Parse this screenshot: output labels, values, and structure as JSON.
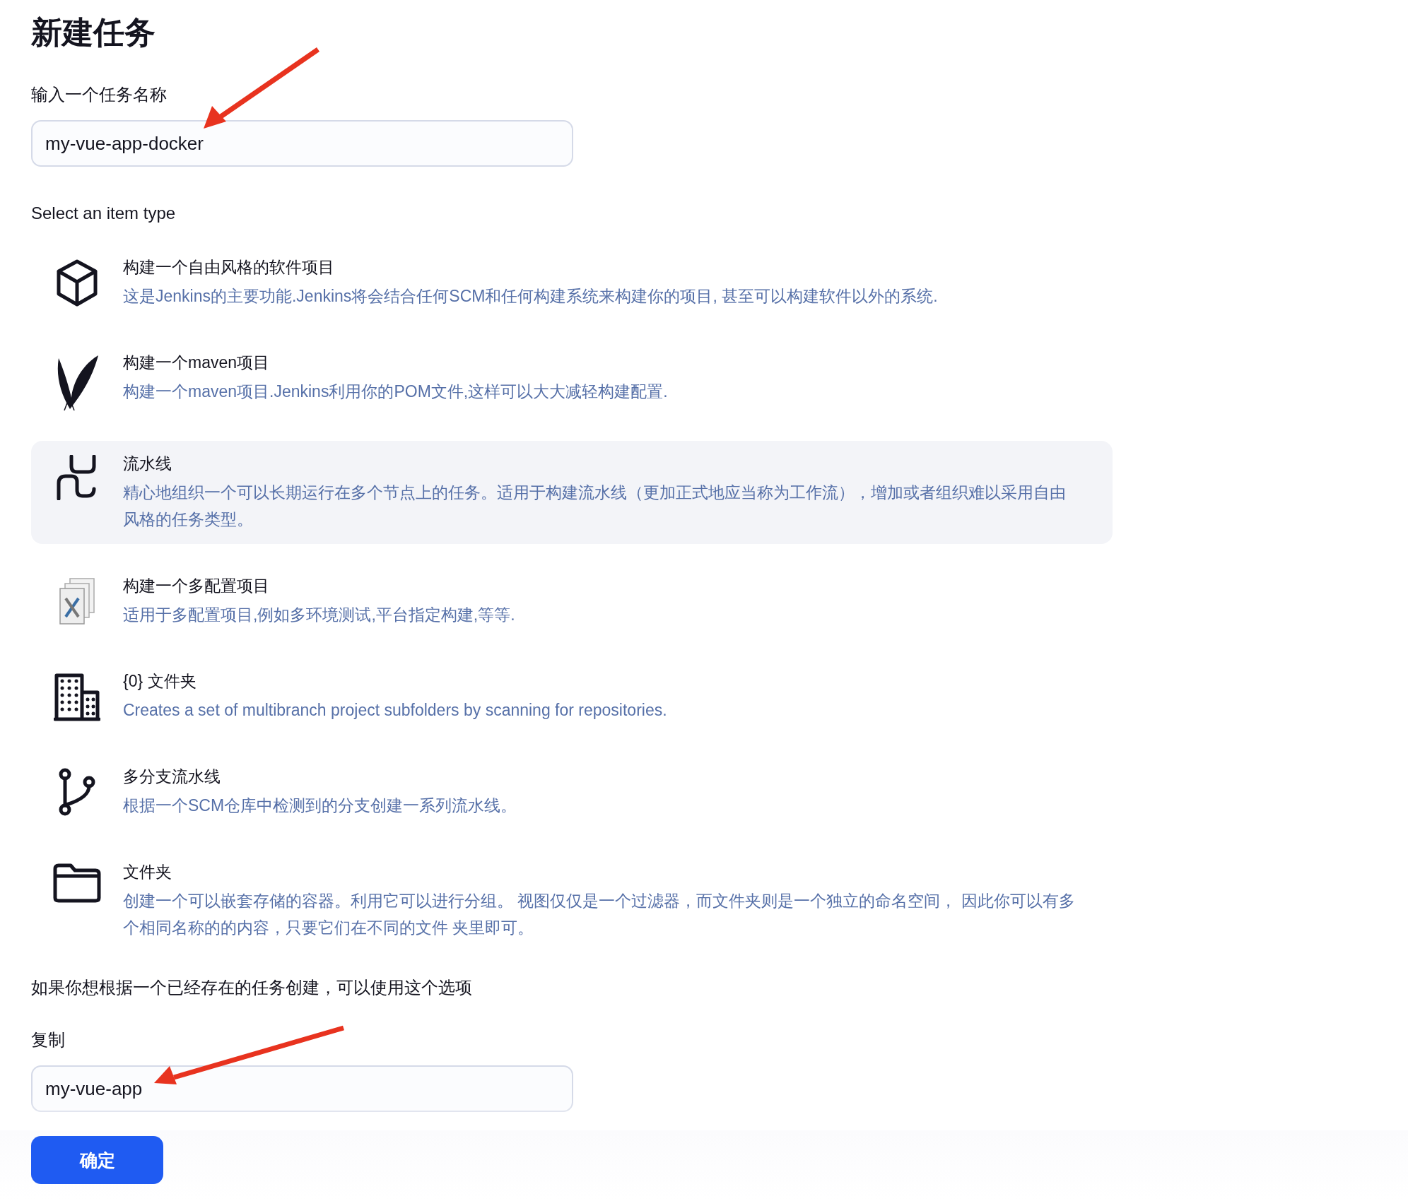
{
  "title": "新建任务",
  "name_field": {
    "label": "输入一个任务名称",
    "value": "my-vue-app-docker"
  },
  "item_type_label": "Select an item type",
  "items": [
    {
      "kind": "cube",
      "selected": false,
      "title": "构建一个自由风格的软件项目",
      "description": "这是Jenkins的主要功能.Jenkins将会结合任何SCM和任何构建系统来构建你的项目, 甚至可以构建软件以外的系统."
    },
    {
      "kind": "feather",
      "selected": false,
      "title": "构建一个maven项目",
      "description": "构建一个maven项目.Jenkins利用你的POM文件,这样可以大大减轻构建配置."
    },
    {
      "kind": "pipe",
      "selected": true,
      "title": "流水线",
      "description": "精心地组织一个可以长期运行在多个节点上的任务。适用于构建流水线（更加正式地应当称为工作流），增加或者组织难以采用自由风格的任务类型。"
    },
    {
      "kind": "documents",
      "selected": false,
      "title": "构建一个多配置项目",
      "description": "适用于多配置项目,例如多环境测试,平台指定构建,等等."
    },
    {
      "kind": "building",
      "selected": false,
      "title": "{0} 文件夹",
      "description": "Creates a set of multibranch project subfolders by scanning for repositories."
    },
    {
      "kind": "branch",
      "selected": false,
      "title": "多分支流水线",
      "description": "根据一个SCM仓库中检测到的分支创建一系列流水线。"
    },
    {
      "kind": "folder",
      "selected": false,
      "title": "文件夹",
      "description": "创建一个可以嵌套存储的容器。利用它可以进行分组。 视图仅仅是一个过滤器，而文件夹则是一个独立的命名空间， 因此你可以有多个相同名称的的内容，只要它们在不同的文件 夹里即可。"
    }
  ],
  "copy_hint": "如果你想根据一个已经存在的任务创建，可以使用这个选项",
  "copy_field": {
    "label": "复制",
    "value": "my-vue-app"
  },
  "ok_button": "确定"
}
